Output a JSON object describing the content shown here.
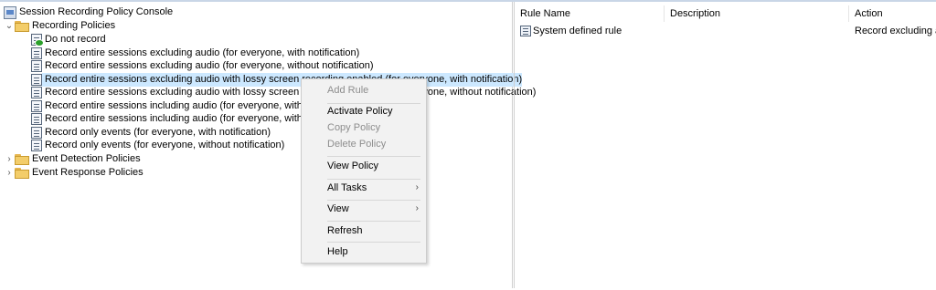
{
  "tree": {
    "root_label": "Session Recording Policy Console",
    "recording_policies_label": "Recording Policies",
    "policies": [
      "Do not record",
      "Record entire sessions excluding audio (for everyone, with notification)",
      "Record entire sessions excluding audio (for everyone, without notification)",
      "Record entire sessions excluding audio with lossy screen recording enabled (for everyone, with notification)",
      "Record entire sessions excluding audio with lossy screen recording enabled (for everyone, without notification)",
      "Record entire sessions including audio (for everyone, with notification)",
      "Record entire sessions including audio (for everyone, without notification)",
      "Record only events (for everyone, with notification)",
      "Record only events (for everyone, without notification)"
    ],
    "event_detection_label": "Event Detection Policies",
    "event_response_label": "Event Response Policies"
  },
  "list": {
    "columns": [
      "Rule Name",
      "Description",
      "Action"
    ],
    "rows": [
      {
        "rule_name": "System defined rule",
        "description": "",
        "action": "Record excluding audio"
      }
    ]
  },
  "context_menu": {
    "items": [
      {
        "label": "Add Rule",
        "enabled": false
      },
      {
        "label": "Activate Policy",
        "enabled": true
      },
      {
        "label": "Copy Policy",
        "enabled": false
      },
      {
        "label": "Delete Policy",
        "enabled": false
      },
      {
        "label": "View Policy",
        "enabled": true
      },
      {
        "label": "All Tasks",
        "enabled": true,
        "submenu": true
      },
      {
        "label": "View",
        "enabled": true,
        "submenu": true
      },
      {
        "label": "Refresh",
        "enabled": true
      },
      {
        "label": "Help",
        "enabled": true
      }
    ],
    "submenu_glyph": "›"
  },
  "glyphs": {
    "collapsed": "›",
    "expanded": "⌄"
  },
  "colors": {
    "selection": "#cce8ff",
    "menu_bg": "#f2f2f2",
    "disabled_text": "#8d8d8d"
  }
}
